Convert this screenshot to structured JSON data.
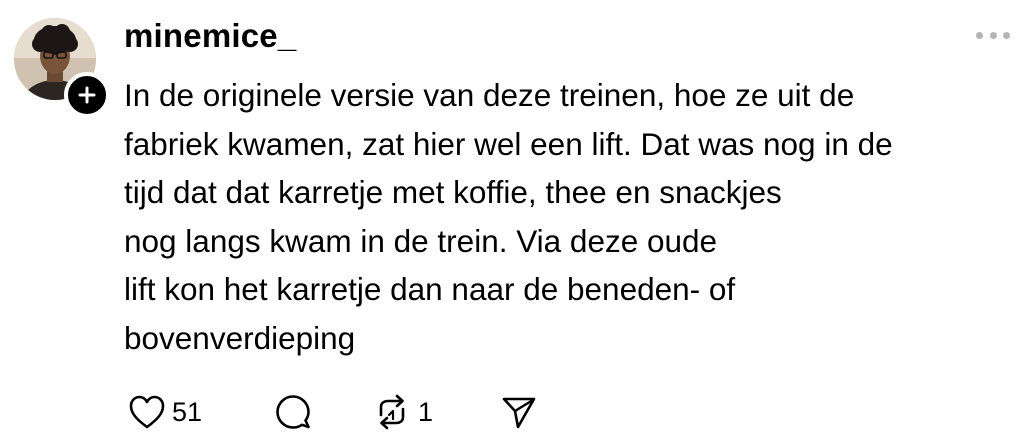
{
  "post": {
    "username": "minemice_",
    "text_lines": [
      "In de originele versie van deze treinen, hoe ze uit de",
      "fabriek kwamen, zat hier wel een lift. Dat was nog in de",
      "tijd dat dat karretje met koffie, thee en snackjes",
      "nog langs kwam in de trein. Via deze oude",
      "lift kon het karretje dan naar de beneden- of",
      "bovenverdieping"
    ],
    "follow_icon": "plus-icon",
    "more_icon": "more-dots-icon"
  },
  "actions": {
    "like_count": "51",
    "like_icon": "heart-icon",
    "comment_icon": "comment-icon",
    "repost_count": "1",
    "repost_icon": "repost-icon",
    "share_icon": "send-icon"
  },
  "colors": {
    "text": "#000000",
    "muted": "#b5b5b5",
    "background": "#ffffff"
  }
}
